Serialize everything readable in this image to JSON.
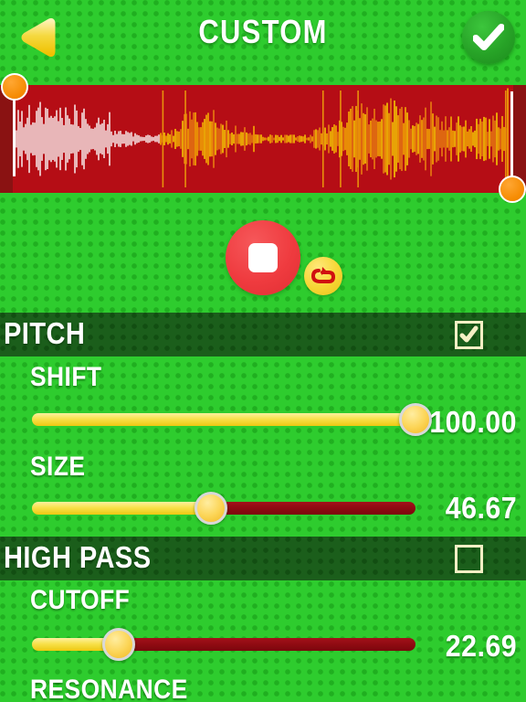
{
  "header": {
    "title": "CUSTOM",
    "back_icon": "back-triangle-icon",
    "confirm_icon": "checkmark-icon"
  },
  "waveform": {
    "selection_start_handle": "selection-start-handle",
    "selection_end_handle": "selection-end-handle",
    "waveform_colors": {
      "background": "#b50d15",
      "unselected": "#ffffff",
      "selected": "#ffd000"
    }
  },
  "transport": {
    "stop_label": "stop-button",
    "loop_label": "loop-button"
  },
  "sections": [
    {
      "name": "PITCH",
      "enabled": true,
      "params": [
        {
          "label": "SHIFT",
          "value": "100.00",
          "percent": 100
        },
        {
          "label": "SIZE",
          "value": "46.67",
          "percent": 46.67
        }
      ]
    },
    {
      "name": "HIGH PASS",
      "enabled": false,
      "params": [
        {
          "label": "CUTOFF",
          "value": "22.69",
          "percent": 22.69
        },
        {
          "label": "RESONANCE",
          "value": "",
          "percent": 0
        }
      ]
    }
  ],
  "colors": {
    "green_bg": "#2ecc2e",
    "dark_green_bar": "#1b5e1b",
    "waveform_red": "#b50d15",
    "accent_yellow": "#f8e14b",
    "handle_orange": "#f58a00",
    "stop_red": "#ef3b3f"
  }
}
